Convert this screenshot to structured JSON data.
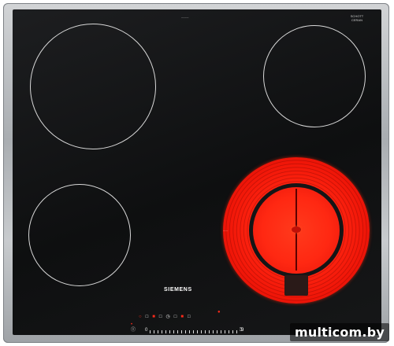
{
  "product": {
    "brand": "SIEMENS",
    "glass_maker_line1": "SCHOTT",
    "glass_maker_line2": "CERAN"
  },
  "zones": [
    {
      "id": "front-left",
      "state": "off"
    },
    {
      "id": "back-left",
      "state": "off"
    },
    {
      "id": "back-right",
      "state": "off"
    },
    {
      "id": "front-right",
      "state": "heating",
      "glow_color": "#ff2a12"
    }
  ],
  "controls": {
    "power_symbol": "Ⓘ",
    "timer_symbol": "◷",
    "lock_symbol": "⚿",
    "minus_symbol": "0",
    "plus_symbol": "9",
    "indicator_color": "#ff2a1a"
  },
  "watermark": {
    "text": "multicom.by"
  }
}
